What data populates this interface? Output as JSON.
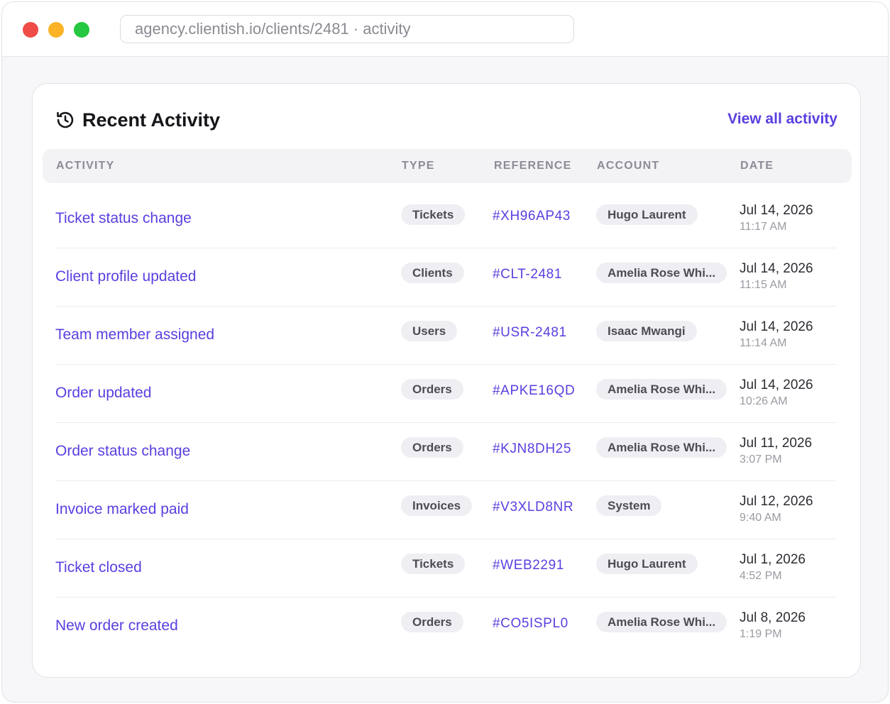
{
  "window": {
    "url": "agency.clientish.io/clients/2481 · activity"
  },
  "card": {
    "title": "Recent Activity",
    "view_all_label": "View all activity",
    "columns": {
      "activity": "ACTIVITY",
      "type": "TYPE",
      "reference": "REFERENCE",
      "account": "ACCOUNT",
      "date": "DATE"
    },
    "rows": [
      {
        "activity": "Ticket status change",
        "type": "Tickets",
        "reference": "#XH96AP43",
        "account": "Hugo Laurent",
        "date": "Jul 14, 2026",
        "time": "11:17 AM"
      },
      {
        "activity": "Client profile updated",
        "type": "Clients",
        "reference": "#CLT-2481",
        "account": "Amelia Rose Whi...",
        "date": "Jul 14, 2026",
        "time": "11:15 AM"
      },
      {
        "activity": "Team member assigned",
        "type": "Users",
        "reference": "#USR-2481",
        "account": "Isaac Mwangi",
        "date": "Jul 14, 2026",
        "time": "11:14 AM"
      },
      {
        "activity": "Order updated",
        "type": "Orders",
        "reference": "#APKE16QD",
        "account": "Amelia Rose Whi...",
        "date": "Jul 14, 2026",
        "time": "10:26 AM"
      },
      {
        "activity": "Order status change",
        "type": "Orders",
        "reference": "#KJN8DH25",
        "account": "Amelia Rose Whi...",
        "date": "Jul 11, 2026",
        "time": "3:07 PM"
      },
      {
        "activity": "Invoice marked paid",
        "type": "Invoices",
        "reference": "#V3XLD8NR",
        "account": "System",
        "date": "Jul 12, 2026",
        "time": "9:40 AM"
      },
      {
        "activity": "Ticket closed",
        "type": "Tickets",
        "reference": "#WEB2291",
        "account": "Hugo Laurent",
        "date": "Jul 1, 2026",
        "time": "4:52 PM"
      },
      {
        "activity": "New order created",
        "type": "Orders",
        "reference": "#CO5ISPL0",
        "account": "Amelia Rose Whi...",
        "date": "Jul 8, 2026",
        "time": "1:19 PM"
      }
    ]
  },
  "colors": {
    "accent": "#5b3ee0",
    "traffic_red": "#ef4b47",
    "traffic_yellow": "#fbb325",
    "traffic_green": "#25c840"
  },
  "icons": {
    "header": "history-icon"
  }
}
